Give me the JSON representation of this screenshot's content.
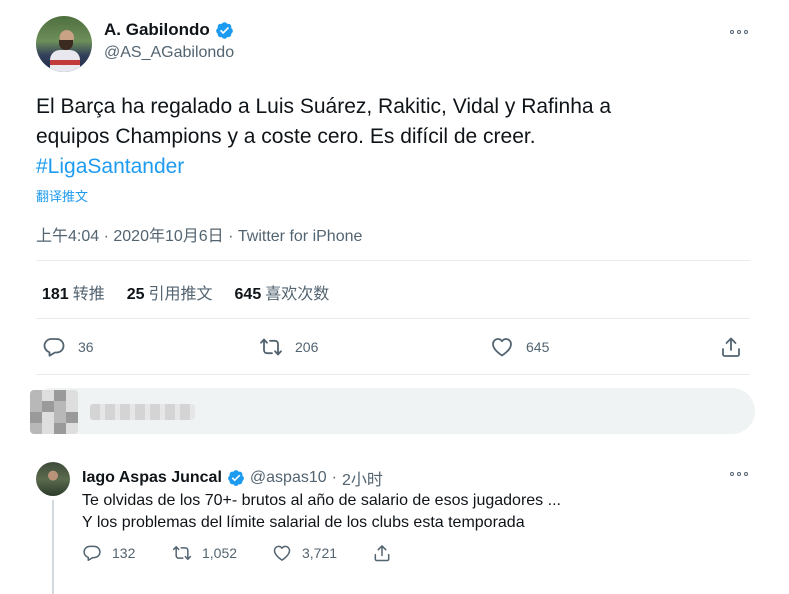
{
  "tweet": {
    "author": {
      "display_name": "A. Gabilondo",
      "handle": "@AS_AGabilondo"
    },
    "text": {
      "line1": "El Barça ha regalado a Luis Suárez, Rakitic, Vidal y Rafinha a",
      "line2": "equipos Champions y a coste cero. Es difícil de creer.",
      "hashtag": "#LigaSantander"
    },
    "translate_label": "翻译推文",
    "meta": {
      "time": "上午4:04",
      "separator1": " · ",
      "date": "2020年10月6日",
      "separator2": " · ",
      "source": "Twitter for iPhone"
    },
    "stats": {
      "retweets_count": "181",
      "retweets_label": "转推",
      "quotes_count": "25",
      "quotes_label": "引用推文",
      "likes_count": "645",
      "likes_label": "喜欢次数"
    },
    "actions": {
      "reply_count": "36",
      "retweet_count": "206",
      "like_count": "645"
    }
  },
  "reply": {
    "author": {
      "display_name": "Iago Aspas Juncal",
      "handle": "@aspas10",
      "dot": "·",
      "time": "2小时"
    },
    "text": {
      "line1": "Te olvidas de los 70+- brutos al año de salario de esos jugadores ...",
      "line2": "Y los problemas del límite salarial de los clubs esta temporada"
    },
    "actions": {
      "reply_count": "132",
      "retweet_count": "1,052",
      "like_count": "3,721"
    }
  },
  "colors": {
    "accent": "#1d9bf0",
    "text_primary": "#0f1419",
    "text_secondary": "#536471",
    "divider": "#e6ecf0"
  },
  "icons": [
    "verified-badge-icon",
    "more-options-icon",
    "reply-icon",
    "retweet-icon",
    "like-icon",
    "share-icon"
  ]
}
